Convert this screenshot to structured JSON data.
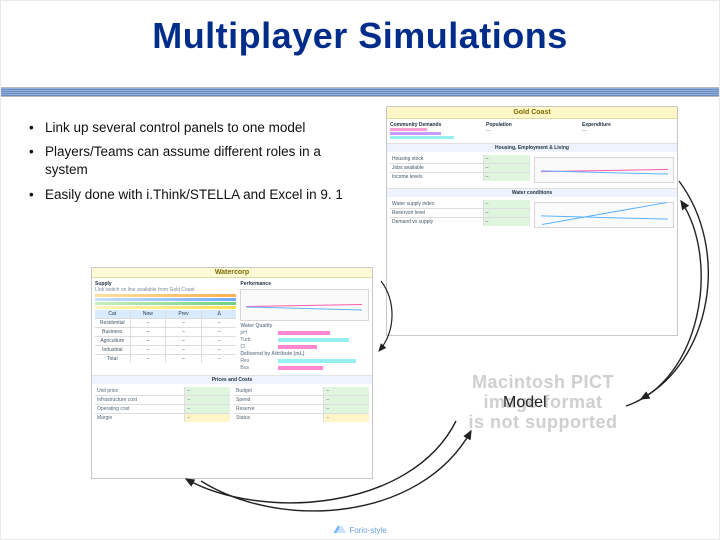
{
  "slide": {
    "title": "Multiplayer Simulations",
    "bullets": [
      "Link up several control panels to one model",
      "Players/Teams can assume different roles in a system",
      "Easily done with i.Think/STELLA and Excel in 9. 1"
    ],
    "model_label": "Model",
    "pict_lines": [
      "Macintosh PICT",
      "image format",
      "is not supported"
    ],
    "footer": "Forio-style"
  },
  "panels": {
    "gold_coast": {
      "title": "Gold Coast",
      "top_row": [
        "Community Demands",
        "Population",
        "Expenditure"
      ],
      "section_housing": "Housing, Employment & Living",
      "housing_left_rows": [
        "Housing stock",
        "Jobs available",
        "Income levels"
      ],
      "section_water": "Water conditions",
      "water_left_rows": [
        "Water supply index",
        "Reservoir level",
        "Demand vs supply"
      ]
    },
    "watercorp": {
      "title": "Watercorp",
      "supply_label": "Supply",
      "perf_label": "Performance",
      "cat_rows": [
        "Residential",
        "Business",
        "Agriculture",
        "Industrial",
        "Total"
      ],
      "quality_label": "Water Quality",
      "delivery_label": "Delivered by Attribute (mL)",
      "prices_label": "Prices and Costs",
      "kv_rows": [
        "Unit price",
        "Infrastructure cost",
        "Operating cost",
        "Margin"
      ]
    }
  }
}
